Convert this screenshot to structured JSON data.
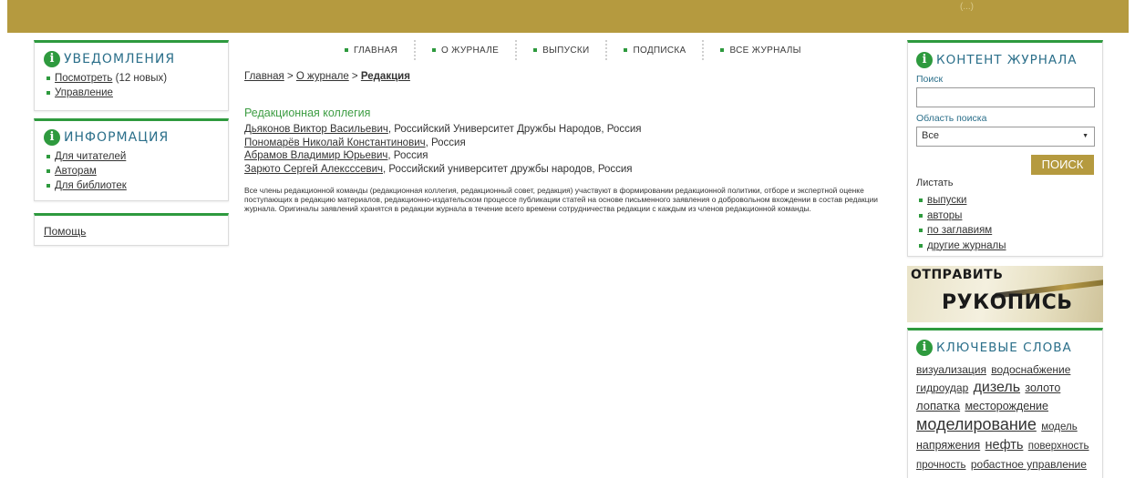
{
  "header": {
    "corner_text": "(...)"
  },
  "notifications": {
    "title": "УВЕДОМЛЕНИЯ",
    "view_link": "Посмотреть",
    "view_count": "(12 новых)",
    "manage_link": "Управление"
  },
  "information": {
    "title": "ИНФОРМАЦИЯ",
    "items": [
      "Для читателей",
      "Авторам",
      "Для библиотек"
    ]
  },
  "help": {
    "label": "Помощь"
  },
  "topnav": {
    "items": [
      "ГЛАВНАЯ",
      "О ЖУРНАЛЕ",
      "ВЫПУСКИ",
      "ПОДПИСКА",
      "ВСЕ ЖУРНАЛЫ"
    ]
  },
  "breadcrumb": {
    "home": "Главная",
    "sep": " > ",
    "about": "О журнале",
    "current": "Редакция"
  },
  "main": {
    "section_title": "Редакционная коллегия",
    "editors": [
      {
        "name": "Дьяконов Виктор Васильевич",
        "affiliation": ", Российский Университет Дружбы Народов, Россия"
      },
      {
        "name": "Пономарёв Николай Константинович",
        "affiliation": ", Россия"
      },
      {
        "name": "Абрамов Владимир Юрьевич",
        "affiliation": ", Россия"
      },
      {
        "name": "Зарюто Сергей Алексссевич",
        "affiliation": ", Российский университет дружбы народов, Россия"
      }
    ],
    "paragraph": "Все члены редакционной команды (редакционная коллегия, редакционный совет, редакция) участвуют в формировании редакционной политики, отборе и экспертной оценке поступающих в редакцию материалов, редакционно-издательском процессе публикации статей на основе письменного заявления о добровольном вхождении в состав редакции журнала. Оригиналы заявлений хранятся в редакции журнала в течение всего времени сотрудничества редакции с каждым из членов редакционной команды."
  },
  "content_panel": {
    "title": "КОНТЕНТ ЖУРНАЛА",
    "search_label": "Поиск",
    "search_value": "",
    "scope_label": "Область поиска",
    "scope_value": "Все",
    "search_button": "ПОИСК",
    "browse_label": "Листать",
    "browse_items": [
      "выпуски",
      "авторы",
      "по заглавиям",
      "другие журналы"
    ]
  },
  "submit_banner": {
    "line1": "ОТПРАВИТЬ",
    "line2": "РУКОПИСЬ"
  },
  "keywords": {
    "title": "КЛЮЧЕВЫЕ СЛОВА",
    "tags": [
      {
        "text": "визуализация",
        "size": 12
      },
      {
        "text": "водоснабжение",
        "size": 12
      },
      {
        "text": "гидроудар",
        "size": 12
      },
      {
        "text": "дизель",
        "size": 16
      },
      {
        "text": "золото",
        "size": 12.5
      },
      {
        "text": "лопатка",
        "size": 13
      },
      {
        "text": "месторождение",
        "size": 12.5
      },
      {
        "text": "моделирование",
        "size": 18
      },
      {
        "text": "модель",
        "size": 11.5
      },
      {
        "text": "напряжения",
        "size": 12.5
      },
      {
        "text": "нефть",
        "size": 14.5
      },
      {
        "text": "поверхность",
        "size": 11.5
      },
      {
        "text": "прочность",
        "size": 11.5
      },
      {
        "text": "робастное управление",
        "size": 12
      }
    ]
  },
  "colors": {
    "accent_green": "#2e9a3e",
    "gold": "#b59a3f",
    "title_blue": "#2b6f8a"
  }
}
